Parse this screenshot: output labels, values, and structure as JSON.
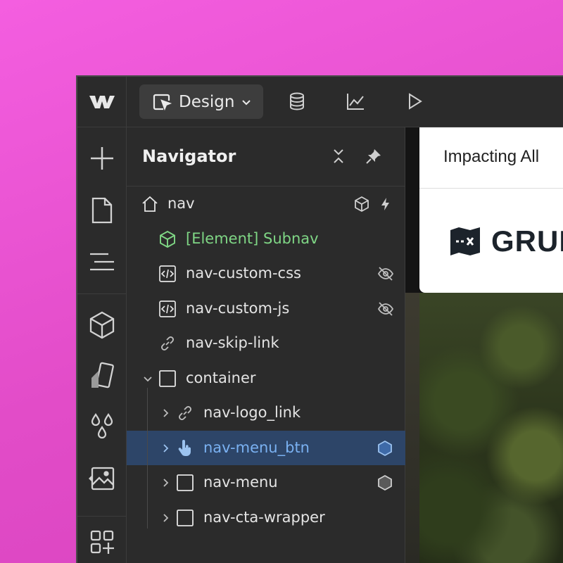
{
  "toolbar": {
    "mode_label": "Design"
  },
  "navigator": {
    "title": "Navigator",
    "items": [
      {
        "label": "nav"
      },
      {
        "label": "[Element] Subnav"
      },
      {
        "label": "nav-custom-css"
      },
      {
        "label": "nav-custom-js"
      },
      {
        "label": "nav-skip-link"
      },
      {
        "label": "container"
      },
      {
        "label": "nav-logo_link"
      },
      {
        "label": "nav-menu_btn"
      },
      {
        "label": "nav-menu"
      },
      {
        "label": "nav-cta-wrapper"
      }
    ]
  },
  "canvas": {
    "banner_text": "Impacting All",
    "brand_name": "GRUN"
  },
  "colors": {
    "selected_bg": "#2d4568",
    "selected_text": "#7ab1f2",
    "component_text": "#7fd685"
  }
}
